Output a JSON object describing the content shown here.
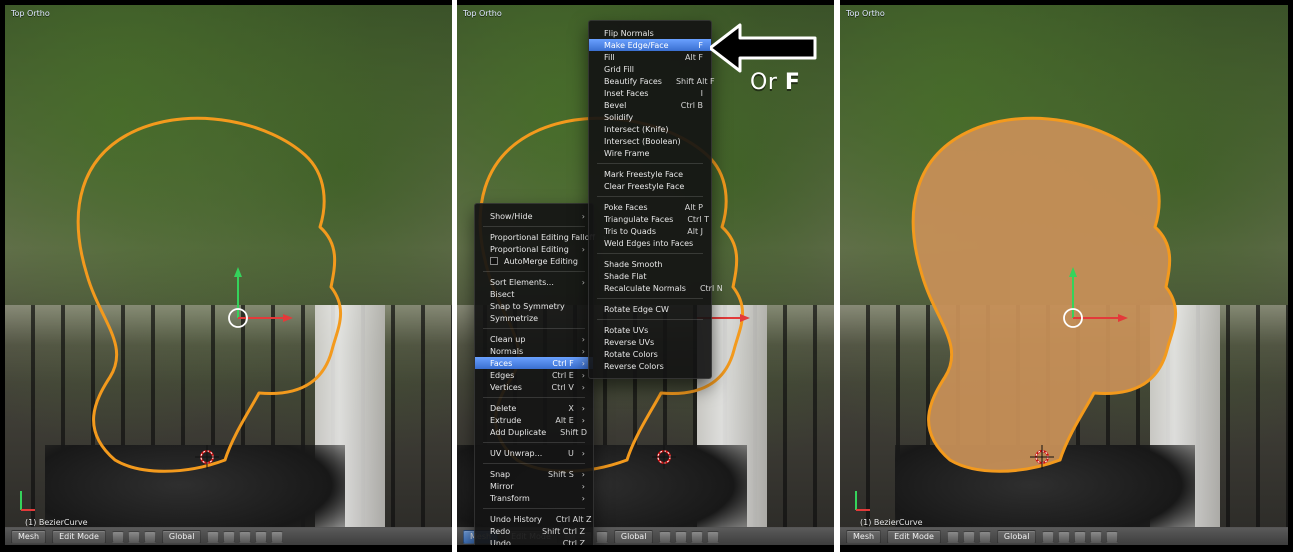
{
  "panels": {
    "left": {
      "view_label": "Top Ortho",
      "object_label": "(1) BezierCurve"
    },
    "middle": {
      "view_label": "Top Ortho"
    },
    "right": {
      "view_label": "Top Ortho",
      "object_label": "(1) BezierCurve"
    }
  },
  "statusbar": {
    "mesh": "Mesh",
    "mode": "Edit Mode",
    "orientation": "Global"
  },
  "menus": {
    "mesh_menu": {
      "items": [
        {
          "label": "Show/Hide",
          "arrow": "›"
        },
        {
          "type": "sep"
        },
        {
          "label": "Proportional Editing Falloff",
          "arrow": "›"
        },
        {
          "label": "Proportional Editing",
          "arrow": "›"
        },
        {
          "label": "AutoMerge Editing",
          "checkbox": true
        },
        {
          "type": "sep"
        },
        {
          "label": "Sort Elements...",
          "arrow": "›"
        },
        {
          "label": "Bisect"
        },
        {
          "label": "Snap to Symmetry"
        },
        {
          "label": "Symmetrize"
        },
        {
          "type": "sep"
        },
        {
          "label": "Clean up",
          "arrow": "›"
        },
        {
          "label": "Normals",
          "arrow": "›"
        },
        {
          "label": "Faces",
          "shortcut": "Ctrl F",
          "arrow": "›",
          "highlight": true
        },
        {
          "label": "Edges",
          "shortcut": "Ctrl E",
          "arrow": "›"
        },
        {
          "label": "Vertices",
          "shortcut": "Ctrl V",
          "arrow": "›"
        },
        {
          "type": "sep"
        },
        {
          "label": "Delete",
          "shortcut": "X",
          "arrow": "›"
        },
        {
          "label": "Extrude",
          "shortcut": "Alt E",
          "arrow": "›"
        },
        {
          "label": "Add Duplicate",
          "shortcut": "Shift D"
        },
        {
          "type": "sep"
        },
        {
          "label": "UV Unwrap...",
          "shortcut": "U",
          "arrow": "›"
        },
        {
          "type": "sep"
        },
        {
          "label": "Snap",
          "shortcut": "Shift S",
          "arrow": "›"
        },
        {
          "label": "Mirror",
          "arrow": "›"
        },
        {
          "label": "Transform",
          "arrow": "›"
        },
        {
          "type": "sep"
        },
        {
          "label": "Undo History",
          "shortcut": "Ctrl Alt Z"
        },
        {
          "label": "Redo",
          "shortcut": "Shift Ctrl Z"
        },
        {
          "label": "Undo",
          "shortcut": "Ctrl Z"
        }
      ]
    },
    "faces_menu": {
      "items": [
        {
          "label": "Flip Normals"
        },
        {
          "label": "Make Edge/Face",
          "shortcut": "F",
          "highlight": true
        },
        {
          "label": "Fill",
          "shortcut": "Alt F"
        },
        {
          "label": "Grid Fill"
        },
        {
          "label": "Beautify Faces",
          "shortcut": "Shift Alt F"
        },
        {
          "label": "Inset Faces",
          "shortcut": "I"
        },
        {
          "label": "Bevel",
          "shortcut": "Ctrl B"
        },
        {
          "label": "Solidify"
        },
        {
          "label": "Intersect (Knife)"
        },
        {
          "label": "Intersect (Boolean)"
        },
        {
          "label": "Wire Frame"
        },
        {
          "type": "sep"
        },
        {
          "label": "Mark Freestyle Face"
        },
        {
          "label": "Clear Freestyle Face"
        },
        {
          "type": "sep"
        },
        {
          "label": "Poke Faces",
          "shortcut": "Alt P"
        },
        {
          "label": "Triangulate Faces",
          "shortcut": "Ctrl T"
        },
        {
          "label": "Tris to Quads",
          "shortcut": "Alt J"
        },
        {
          "label": "Weld Edges into Faces"
        },
        {
          "type": "sep"
        },
        {
          "label": "Shade Smooth"
        },
        {
          "label": "Shade Flat"
        },
        {
          "label": "Recalculate Normals",
          "shortcut": "Ctrl N"
        },
        {
          "type": "sep"
        },
        {
          "label": "Rotate Edge CW"
        },
        {
          "type": "sep"
        },
        {
          "label": "Rotate UVs"
        },
        {
          "label": "Reverse UVs"
        },
        {
          "label": "Rotate Colors"
        },
        {
          "label": "Reverse Colors"
        }
      ]
    }
  },
  "annotation": {
    "or_text": "Or ",
    "key": "F"
  },
  "colors": {
    "outline": "#f39a1d",
    "fill": "#c68f57",
    "highlight": "#3a6fd0",
    "panel_divider": "#ffffff"
  }
}
